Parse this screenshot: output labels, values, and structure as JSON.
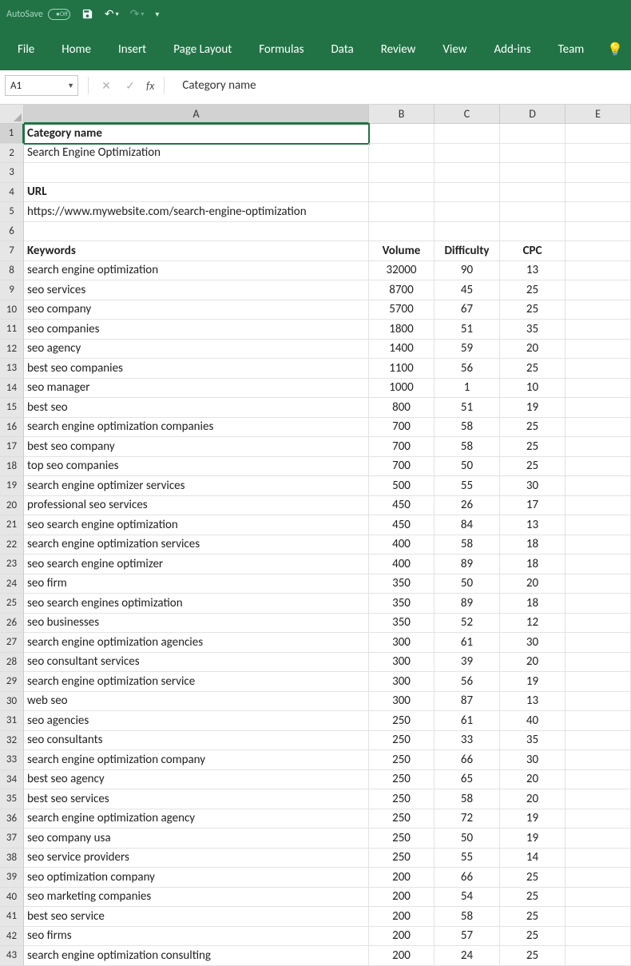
{
  "titlebar": {
    "autosave": "AutoSave",
    "off": "Off"
  },
  "ribbon": {
    "tabs": [
      "File",
      "Home",
      "Insert",
      "Page Layout",
      "Formulas",
      "Data",
      "Review",
      "View",
      "Add-ins",
      "Team"
    ]
  },
  "formulabar": {
    "namebox": "A1",
    "value": "Category name"
  },
  "columns": [
    "A",
    "B",
    "C",
    "D",
    "E"
  ],
  "rows": [
    {
      "n": "1",
      "a": "Category name",
      "bold": true,
      "active": true
    },
    {
      "n": "2",
      "a": "Search Engine Optimization"
    },
    {
      "n": "3",
      "a": ""
    },
    {
      "n": "4",
      "a": "URL",
      "bold": true
    },
    {
      "n": "5",
      "a": "https://www.mywebsite.com/search-engine-optimization"
    },
    {
      "n": "6",
      "a": ""
    },
    {
      "n": "7",
      "a": "Keywords",
      "b": "Volume",
      "c": "Difficulty",
      "d": "CPC",
      "bold": true,
      "rowbold": true
    },
    {
      "n": "8",
      "a": "search engine optimization",
      "b": "32000",
      "c": "90",
      "d": "13"
    },
    {
      "n": "9",
      "a": "seo services",
      "b": "8700",
      "c": "45",
      "d": "25"
    },
    {
      "n": "10",
      "a": "seo company",
      "b": "5700",
      "c": "67",
      "d": "25"
    },
    {
      "n": "11",
      "a": "seo companies",
      "b": "1800",
      "c": "51",
      "d": "35"
    },
    {
      "n": "12",
      "a": "seo agency",
      "b": "1400",
      "c": "59",
      "d": "20"
    },
    {
      "n": "13",
      "a": "best seo companies",
      "b": "1100",
      "c": "56",
      "d": "25"
    },
    {
      "n": "14",
      "a": "seo manager",
      "b": "1000",
      "c": "1",
      "d": "10"
    },
    {
      "n": "15",
      "a": "best seo",
      "b": "800",
      "c": "51",
      "d": "19"
    },
    {
      "n": "16",
      "a": "search engine optimization companies",
      "b": "700",
      "c": "58",
      "d": "25"
    },
    {
      "n": "17",
      "a": "best seo company",
      "b": "700",
      "c": "58",
      "d": "25"
    },
    {
      "n": "18",
      "a": "top seo companies",
      "b": "700",
      "c": "50",
      "d": "25"
    },
    {
      "n": "19",
      "a": "search engine optimizer services",
      "b": "500",
      "c": "55",
      "d": "30"
    },
    {
      "n": "20",
      "a": "professional seo services",
      "b": "450",
      "c": "26",
      "d": "17"
    },
    {
      "n": "21",
      "a": "seo search engine optimization",
      "b": "450",
      "c": "84",
      "d": "13"
    },
    {
      "n": "22",
      "a": "search engine optimization services",
      "b": "400",
      "c": "58",
      "d": "18"
    },
    {
      "n": "23",
      "a": "seo search engine optimizer",
      "b": "400",
      "c": "89",
      "d": "18"
    },
    {
      "n": "24",
      "a": "seo firm",
      "b": "350",
      "c": "50",
      "d": "20"
    },
    {
      "n": "25",
      "a": "seo search engines optimization",
      "b": "350",
      "c": "89",
      "d": "18"
    },
    {
      "n": "26",
      "a": "seo businesses",
      "b": "350",
      "c": "52",
      "d": "12"
    },
    {
      "n": "27",
      "a": "search engine optimization agencies",
      "b": "300",
      "c": "61",
      "d": "30"
    },
    {
      "n": "28",
      "a": "seo consultant services",
      "b": "300",
      "c": "39",
      "d": "20"
    },
    {
      "n": "29",
      "a": "search engine optimization service",
      "b": "300",
      "c": "56",
      "d": "19"
    },
    {
      "n": "30",
      "a": "web seo",
      "b": "300",
      "c": "87",
      "d": "13"
    },
    {
      "n": "31",
      "a": "seo agencies",
      "b": "250",
      "c": "61",
      "d": "40"
    },
    {
      "n": "32",
      "a": "seo consultants",
      "b": "250",
      "c": "33",
      "d": "35"
    },
    {
      "n": "33",
      "a": "search engine optimization company",
      "b": "250",
      "c": "66",
      "d": "30"
    },
    {
      "n": "34",
      "a": "best seo agency",
      "b": "250",
      "c": "65",
      "d": "20"
    },
    {
      "n": "35",
      "a": "best seo services",
      "b": "250",
      "c": "58",
      "d": "20"
    },
    {
      "n": "36",
      "a": "search engine optimization agency",
      "b": "250",
      "c": "72",
      "d": "19"
    },
    {
      "n": "37",
      "a": "seo company usa",
      "b": "250",
      "c": "50",
      "d": "19"
    },
    {
      "n": "38",
      "a": "seo service providers",
      "b": "250",
      "c": "55",
      "d": "14"
    },
    {
      "n": "39",
      "a": "seo optimization company",
      "b": "200",
      "c": "66",
      "d": "25"
    },
    {
      "n": "40",
      "a": "seo marketing companies",
      "b": "200",
      "c": "54",
      "d": "25"
    },
    {
      "n": "41",
      "a": "best seo service",
      "b": "200",
      "c": "58",
      "d": "25"
    },
    {
      "n": "42",
      "a": "seo firms",
      "b": "200",
      "c": "57",
      "d": "25"
    },
    {
      "n": "43",
      "a": "search engine optimization consulting",
      "b": "200",
      "c": "24",
      "d": "25"
    }
  ]
}
